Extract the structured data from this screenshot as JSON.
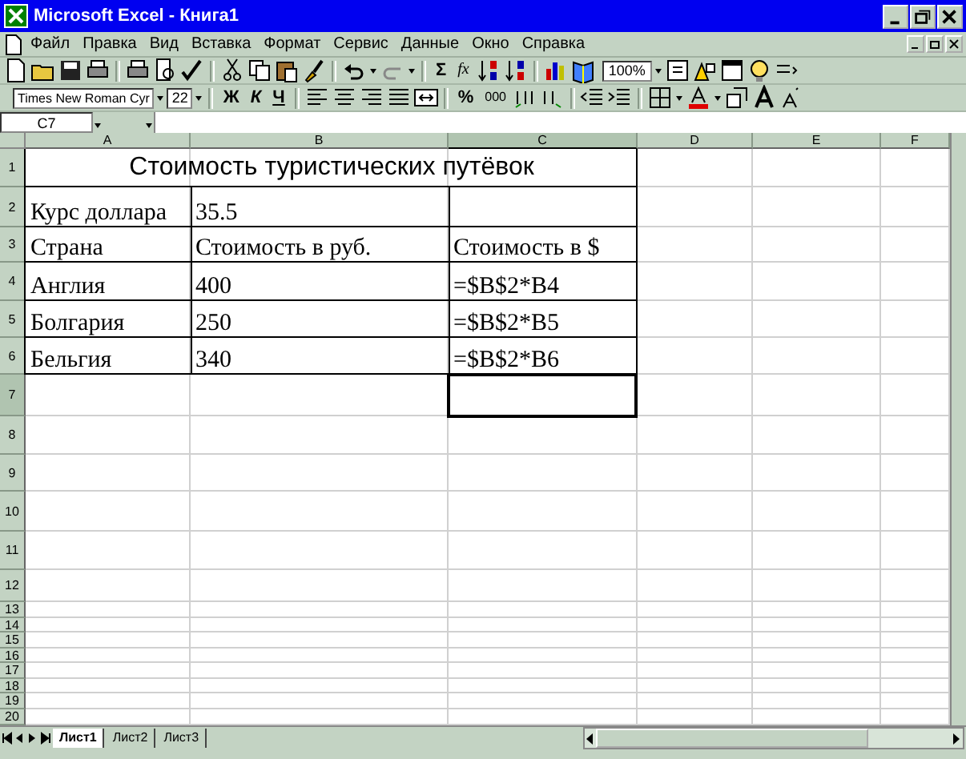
{
  "window": {
    "title": "Microsoft Excel - Книга1"
  },
  "menu": [
    "Файл",
    "Правка",
    "Вид",
    "Вставка",
    "Формат",
    "Сервис",
    "Данные",
    "Окно",
    "Справка"
  ],
  "standard_toolbar": {
    "sum": "Σ",
    "function": "fx",
    "zoom": "100%"
  },
  "formatting_toolbar": {
    "font": "Times New Roman Cyr",
    "size": "22",
    "bold": "Ж",
    "italic": "К",
    "underline": "Ч",
    "percent": "%",
    "thousands": "000"
  },
  "formula_bar": {
    "name_box": "C7"
  },
  "columns": [
    {
      "label": "A",
      "selected": false
    },
    {
      "label": "B",
      "selected": false
    },
    {
      "label": "C",
      "selected": true
    },
    {
      "label": "D",
      "selected": false
    },
    {
      "label": "E",
      "selected": false
    },
    {
      "label": "F",
      "selected": false
    }
  ],
  "rows": [
    {
      "number": "1",
      "selected": false,
      "bordered": true,
      "cells": [
        {
          "kind": "merged",
          "text": "Стоимость туристических путёвок"
        }
      ]
    },
    {
      "number": "2",
      "selected": false,
      "bordered": true,
      "cells": [
        {
          "kind": "text",
          "text": "Курс доллара"
        },
        {
          "kind": "text",
          "text": "35.5"
        }
      ]
    },
    {
      "number": "3",
      "selected": false,
      "bordered": true,
      "cells": [
        {
          "kind": "text",
          "text": "Страна"
        },
        {
          "kind": "text",
          "text": "Стоимость в руб."
        },
        {
          "kind": "text",
          "text": "Стоимость в $"
        }
      ]
    },
    {
      "number": "4",
      "selected": false,
      "bordered": true,
      "cells": [
        {
          "kind": "text",
          "text": "Англия"
        },
        {
          "kind": "text",
          "text": "400"
        },
        {
          "kind": "text",
          "text": "=$B$2*B4"
        }
      ]
    },
    {
      "number": "5",
      "selected": false,
      "bordered": true,
      "cells": [
        {
          "kind": "text",
          "text": "Болгария"
        },
        {
          "kind": "text",
          "text": "250"
        },
        {
          "kind": "text",
          "text": "=$B$2*B5"
        }
      ]
    },
    {
      "number": "6",
      "selected": false,
      "bordered": true,
      "cells": [
        {
          "kind": "text",
          "text": "Бельгия"
        },
        {
          "kind": "text",
          "text": "340"
        },
        {
          "kind": "text",
          "text": "=$B$2*B6"
        }
      ]
    },
    {
      "number": "7",
      "selected": true,
      "bordered": false
    },
    {
      "number": "8",
      "selected": false,
      "bordered": false
    },
    {
      "number": "9",
      "selected": false,
      "bordered": false
    },
    {
      "number": "10",
      "selected": false,
      "bordered": false
    },
    {
      "number": "11",
      "selected": false,
      "bordered": false
    },
    {
      "number": "12",
      "selected": false,
      "bordered": false
    },
    {
      "number": "13",
      "selected": false,
      "bordered": false
    },
    {
      "number": "14",
      "selected": false,
      "bordered": false
    },
    {
      "number": "15",
      "selected": false,
      "bordered": false
    },
    {
      "number": "16",
      "selected": false,
      "bordered": false
    },
    {
      "number": "17",
      "selected": false,
      "bordered": false
    },
    {
      "number": "18",
      "selected": false,
      "bordered": false
    },
    {
      "number": "19",
      "selected": false,
      "bordered": false
    },
    {
      "number": "20",
      "selected": false,
      "bordered": false
    }
  ],
  "sheet_tabs": [
    {
      "label": "Лист1",
      "selected": true
    },
    {
      "label": "Лист2",
      "selected": false
    },
    {
      "label": "Лист3",
      "selected": false
    }
  ]
}
